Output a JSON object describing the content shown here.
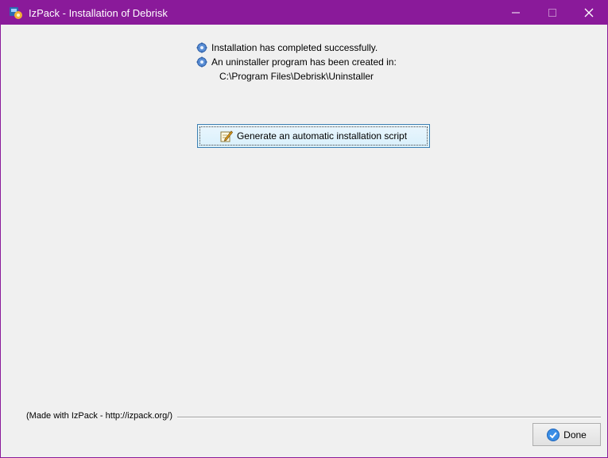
{
  "window": {
    "title": "IzPack - Installation of Debrisk",
    "app_icon": "izpack-app-icon",
    "controls": [
      "minimize-icon",
      "maximize-icon",
      "close-icon"
    ],
    "accent": "#8a1a9a"
  },
  "info": {
    "line1": "Installation has completed successfully.",
    "line2": "An uninstaller program has been created in:",
    "path": "C:\\Program Files\\Debrisk\\Uninstaller",
    "icon": "gear-icon"
  },
  "generate_button": {
    "label": "Generate an automatic installation script",
    "icon": "pencil-icon"
  },
  "footer": {
    "made_with": "(Made with IzPack - http://izpack.org/)",
    "done_label": "Done",
    "done_icon": "checkmark-icon"
  }
}
